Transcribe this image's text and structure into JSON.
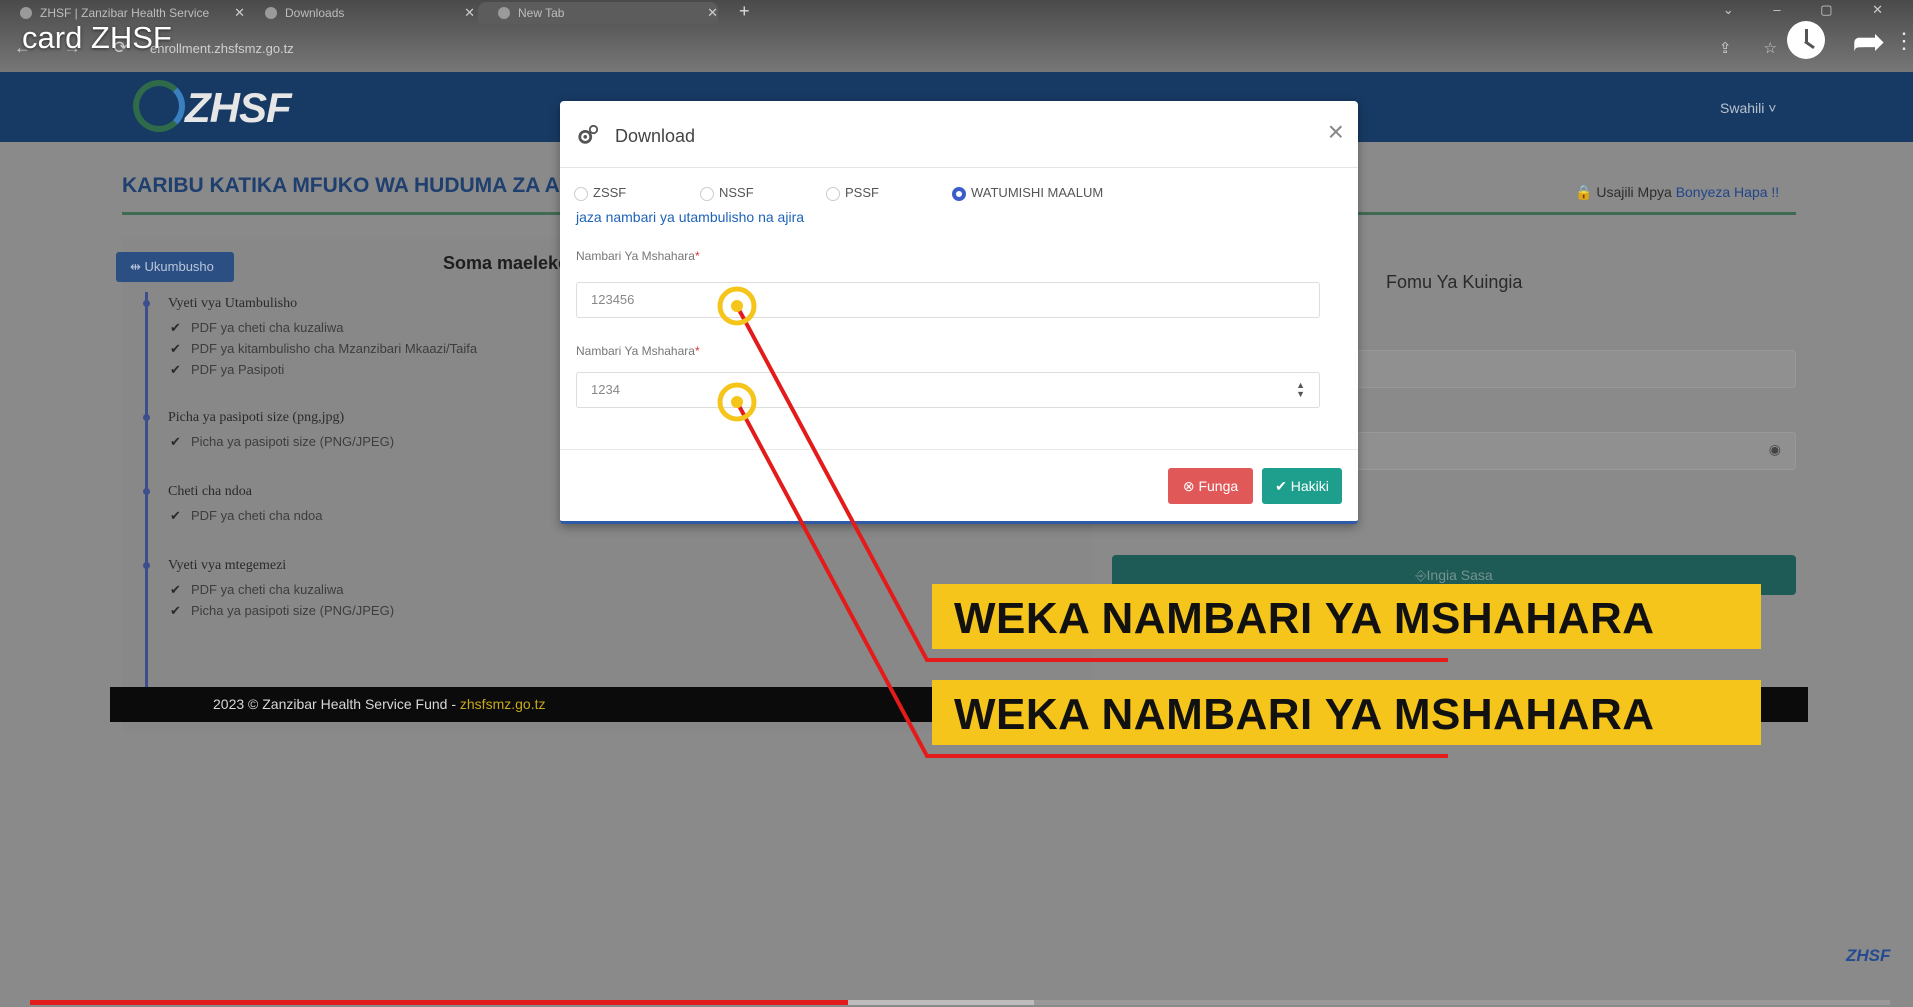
{
  "video": {
    "title": "card ZHSF",
    "progress_fraction": 0.44,
    "buffered_fraction": 0.54,
    "watermark": "ZHSF"
  },
  "browser": {
    "tabs": [
      {
        "label": "ZHSF | Zanzibar Health Service",
        "active": false
      },
      {
        "label": "Downloads",
        "active": false
      },
      {
        "label": "New Tab",
        "active": true
      }
    ],
    "address": "enrollment.zhsfsmz.go.tz"
  },
  "site": {
    "logo_text": "ZHSF",
    "language": "Swahili ˅",
    "welcome": "KARIBU KATIKA MFUKO WA HUDUMA ZA AFYA ZANZIBAR",
    "register_prefix": "Usajili Mpya",
    "register_link": "Bonyeza Hapa !!",
    "ukumbusho": "Ukumbusho",
    "soma": "Soma maelekezo",
    "timeline": [
      {
        "title": "Vyeti vya Utambulisho",
        "items": [
          "PDF ya cheti cha kuzaliwa",
          "PDF ya kitambulisho cha Mzanzibari Mkaazi/Taifa",
          "PDF ya Pasipoti"
        ]
      },
      {
        "title": "Picha ya pasipoti size (png,jpg)",
        "items": [
          "Picha ya pasipoti size (PNG/JPEG)"
        ]
      },
      {
        "title": "Cheti cha ndoa",
        "items": [
          "PDF ya cheti cha ndoa"
        ]
      },
      {
        "title": "Vyeti vya mtegemezi",
        "items": [
          "PDF ya cheti cha kuzaliwa",
          "Picha ya pasipoti size (PNG/JPEG)"
        ]
      }
    ],
    "login_title": "Fomu Ya Kuingia",
    "login_button": "Ingia Sasa",
    "footer_text": "2023 © Zanzibar Health Service Fund - ",
    "footer_link": "zhsfsmz.go.tz"
  },
  "modal": {
    "title": "Download",
    "close": "×",
    "radios": [
      {
        "label": "ZSSF",
        "checked": false
      },
      {
        "label": "NSSF",
        "checked": false
      },
      {
        "label": "PSSF",
        "checked": false
      },
      {
        "label": "WATUMISHI MAALUM",
        "checked": true
      }
    ],
    "hint": "jaza nambari ya utambulisho na ajira",
    "field1_label": "Nambari Ya Mshahara",
    "field1_value": "123456",
    "field2_label": "Nambari Ya Mshahara",
    "field2_value": "1234",
    "required_mark": "*",
    "cancel_button": "Funga",
    "submit_button": "Hakiki"
  },
  "annotation": {
    "banners": [
      "WEKA NAMBARI YA MSHAHARA",
      "WEKA NAMBARI YA MSHAHARA"
    ],
    "accent_colors": {
      "ring": "#f6c51b",
      "line": "#e31b1b"
    }
  }
}
